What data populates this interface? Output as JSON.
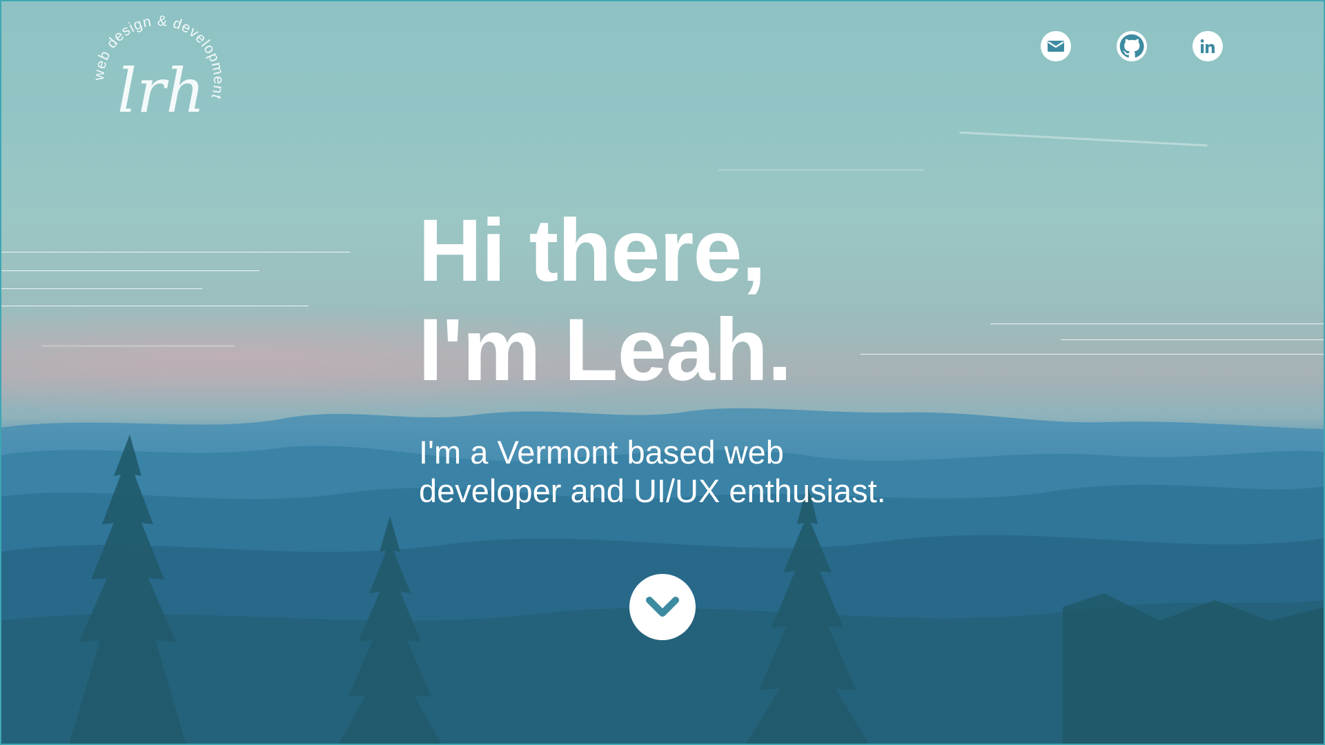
{
  "logo": {
    "ring_text": "web design & development",
    "monogram": "lrh",
    "icon": "lrh-monogram-logo"
  },
  "social": [
    {
      "name": "email",
      "icon": "envelope-icon"
    },
    {
      "name": "github",
      "icon": "github-icon"
    },
    {
      "name": "linkedin",
      "icon": "linkedin-icon"
    }
  ],
  "hero": {
    "headline_line1": "Hi there,",
    "headline_line2": "I'm Leah.",
    "subhead_line1": "I'm a Vermont based web",
    "subhead_line2": "developer and UI/UX enthusiast.",
    "scroll_icon": "chevron-down-icon"
  },
  "colors": {
    "text": "#ffffff",
    "icon_fill": "#3d8ba0",
    "frame_border": "#3fa6b3"
  }
}
